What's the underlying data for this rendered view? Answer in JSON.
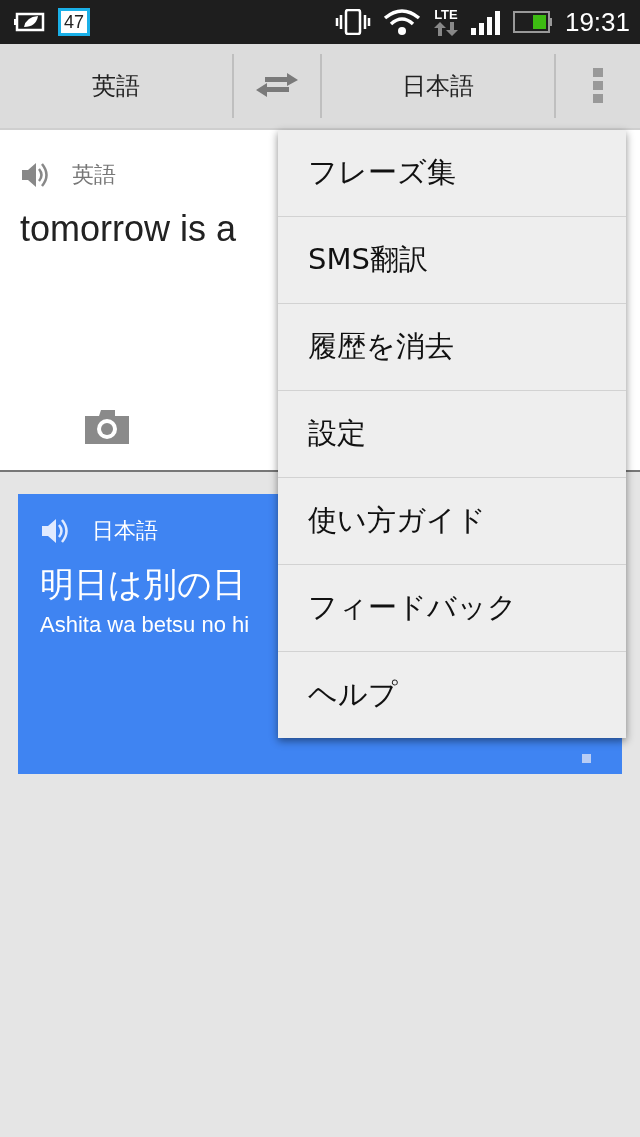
{
  "status_bar": {
    "notification_badge": "47",
    "network": "LTE",
    "time": "19:31"
  },
  "toolbar": {
    "source_language": "英語",
    "target_language": "日本語"
  },
  "input_card": {
    "language": "英語",
    "text": "tomorrow is a"
  },
  "result_card": {
    "language": "日本語",
    "translation": "明日は別の日",
    "romanization": "Ashita wa betsu no hi"
  },
  "overflow_menu": {
    "items": [
      {
        "label": "フレーズ集"
      },
      {
        "label": "SMS翻訳"
      },
      {
        "label": "履歴を消去"
      },
      {
        "label": "設定"
      },
      {
        "label": "使い方ガイド"
      },
      {
        "label": "フィードバック"
      },
      {
        "label": "ヘルプ"
      }
    ]
  }
}
